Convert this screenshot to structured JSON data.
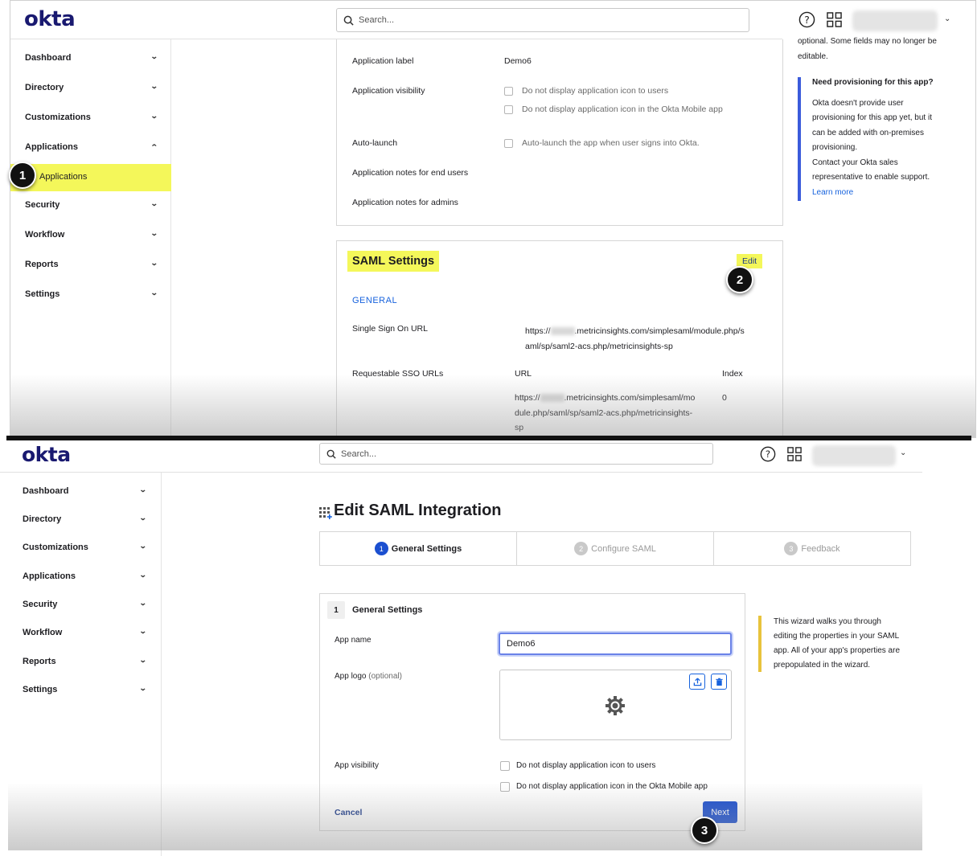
{
  "top": {
    "logo": "okta",
    "search_placeholder": "Search...",
    "sidebar": [
      "Dashboard",
      "Directory",
      "Customizations",
      "Applications",
      "Security",
      "Workflow",
      "Reports",
      "Settings"
    ],
    "sub_item": "Applications",
    "app_settings": {
      "rows": [
        {
          "label": "Application label",
          "value": "Demo6"
        },
        {
          "label": "Application visibility",
          "options": [
            "Do not display application icon to users",
            "Do not display application icon in the Okta Mobile app"
          ]
        },
        {
          "label": "Auto-launch",
          "options": [
            "Auto-launch the app when user signs into Okta."
          ]
        },
        {
          "label": "Application notes for end users"
        },
        {
          "label": "Application notes for admins"
        }
      ]
    },
    "saml": {
      "title": "SAML Settings",
      "edit": "Edit",
      "general": "GENERAL",
      "sso_label": "Single Sign On URL",
      "sso_prefix": "https://",
      "sso_line1": ".metricinsights.com/simplesaml/module.php/s",
      "sso_line2": "aml/sp/saml2-acs.php/metricinsights-sp",
      "req_label": "Requestable SSO URLs",
      "col_url": "URL",
      "col_index": "Index",
      "req_prefix": "https://",
      "req_line1": ".metricinsights.com/simplesaml/mo",
      "req_line2": "dule.php/saml/sp/saml2-acs.php/metricinsights-",
      "req_line3": "sp",
      "req_index": "0"
    },
    "right": {
      "top_line1": "optional. Some fields may no longer be",
      "top_line2": "editable.",
      "heading": "Need provisioning for this app?",
      "lines": [
        "Okta doesn't provide user",
        "provisioning for this app yet, but it",
        "can be added with on-premises",
        "provisioning.",
        "Contact your Okta sales",
        "representative to enable support."
      ],
      "link": "Learn more"
    }
  },
  "bottom": {
    "logo": "okta",
    "search_placeholder": "Search...",
    "sidebar": [
      "Dashboard",
      "Directory",
      "Customizations",
      "Applications",
      "Security",
      "Workflow",
      "Reports",
      "Settings"
    ],
    "page_title": "Edit SAML Integration",
    "steps": [
      {
        "num": "1",
        "label": "General Settings"
      },
      {
        "num": "2",
        "label": "Configure SAML"
      },
      {
        "num": "3",
        "label": "Feedback"
      }
    ],
    "section_num": "1",
    "section_title": "General Settings",
    "app_name_label": "App name",
    "app_name_value": "Demo6",
    "app_logo_label": "App logo",
    "app_logo_optional": "(optional)",
    "app_visibility_label": "App visibility",
    "visibility_options": [
      "Do not display application icon to users",
      "Do not display application icon in the Okta Mobile app"
    ],
    "cancel": "Cancel",
    "next": "Next",
    "hint": [
      "This wizard walks you through",
      "editing the properties in your SAML",
      "app. All of your app's properties are",
      "prepopulated in the wizard."
    ]
  },
  "badges": [
    "1",
    "2",
    "3"
  ],
  "colors": {
    "brand": "#191970",
    "highlight": "#f4f75a",
    "link": "#1662dd",
    "primary_button": "#1b4fd0",
    "provision_bar": "#3b5bdb",
    "hint_bar": "#e8c33c"
  }
}
